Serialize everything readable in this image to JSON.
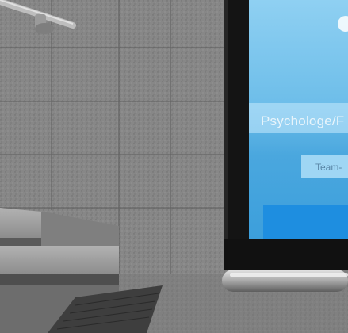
{
  "screen": {
    "headline": "Psychologe/F",
    "team_label": "Team-",
    "background_color": "#5fb0e3",
    "button_color": "#1e8ee0"
  },
  "scene": {
    "wall_color": "#8a8a8a",
    "floor_color": "#6f6f6f",
    "frame_color": "#151515"
  }
}
